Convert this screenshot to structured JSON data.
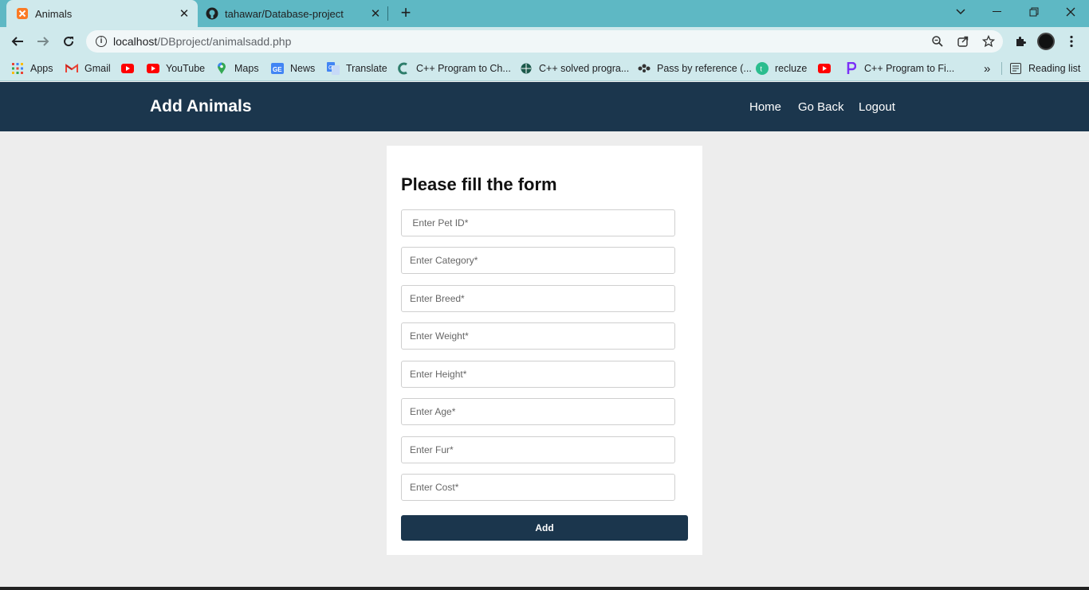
{
  "browser": {
    "tabs": [
      {
        "title": "Animals",
        "icon": "xampp-icon",
        "active": true
      },
      {
        "title": "tahawar/Database-project",
        "icon": "github-icon",
        "active": false
      }
    ],
    "new_tab": "+",
    "address": {
      "host": "localhost",
      "path": "/DBproject/animalsadd.php"
    },
    "bookmarks": [
      {
        "label": "Apps",
        "icon": "apps-grid-icon"
      },
      {
        "label": "Gmail",
        "icon": "gmail-icon"
      },
      {
        "label": "",
        "icon": "youtube-icon"
      },
      {
        "label": "YouTube",
        "icon": "youtube-icon"
      },
      {
        "label": "Maps",
        "icon": "maps-pin-icon"
      },
      {
        "label": "News",
        "icon": "news-icon"
      },
      {
        "label": "Translate",
        "icon": "translate-icon"
      },
      {
        "label": "C++ Program to Ch...",
        "icon": "site-c-icon"
      },
      {
        "label": "C++ solved progra...",
        "icon": "site-globe-icon"
      },
      {
        "label": "Pass by reference (...",
        "icon": "site-dots-icon"
      },
      {
        "label": "recluze",
        "icon": "recluze-icon"
      },
      {
        "label": "",
        "icon": "youtube-icon"
      },
      {
        "label": "C++ Program to Fi...",
        "icon": "site-p-icon"
      }
    ],
    "more": "»",
    "reading_list": "Reading list"
  },
  "header": {
    "title": "Add Animals",
    "nav": [
      "Home",
      "Go Back",
      "Logout"
    ]
  },
  "form": {
    "heading": "Please fill the form",
    "fields": [
      {
        "placeholder": " Enter Pet ID*",
        "value": ""
      },
      {
        "placeholder": "Enter Category*",
        "value": ""
      },
      {
        "placeholder": "Enter Breed*",
        "value": ""
      },
      {
        "placeholder": "Enter Weight*",
        "value": ""
      },
      {
        "placeholder": "Enter Height*",
        "value": ""
      },
      {
        "placeholder": "Enter Age*",
        "value": ""
      },
      {
        "placeholder": "Enter Fur*",
        "value": ""
      },
      {
        "placeholder": "Enter Cost*",
        "value": ""
      }
    ],
    "submit_label": "Add"
  },
  "colors": {
    "tabstrip": "#5eb8c4",
    "toolbar": "#cfe9ec",
    "header": "#1b364d",
    "page_bg": "#ededed"
  }
}
